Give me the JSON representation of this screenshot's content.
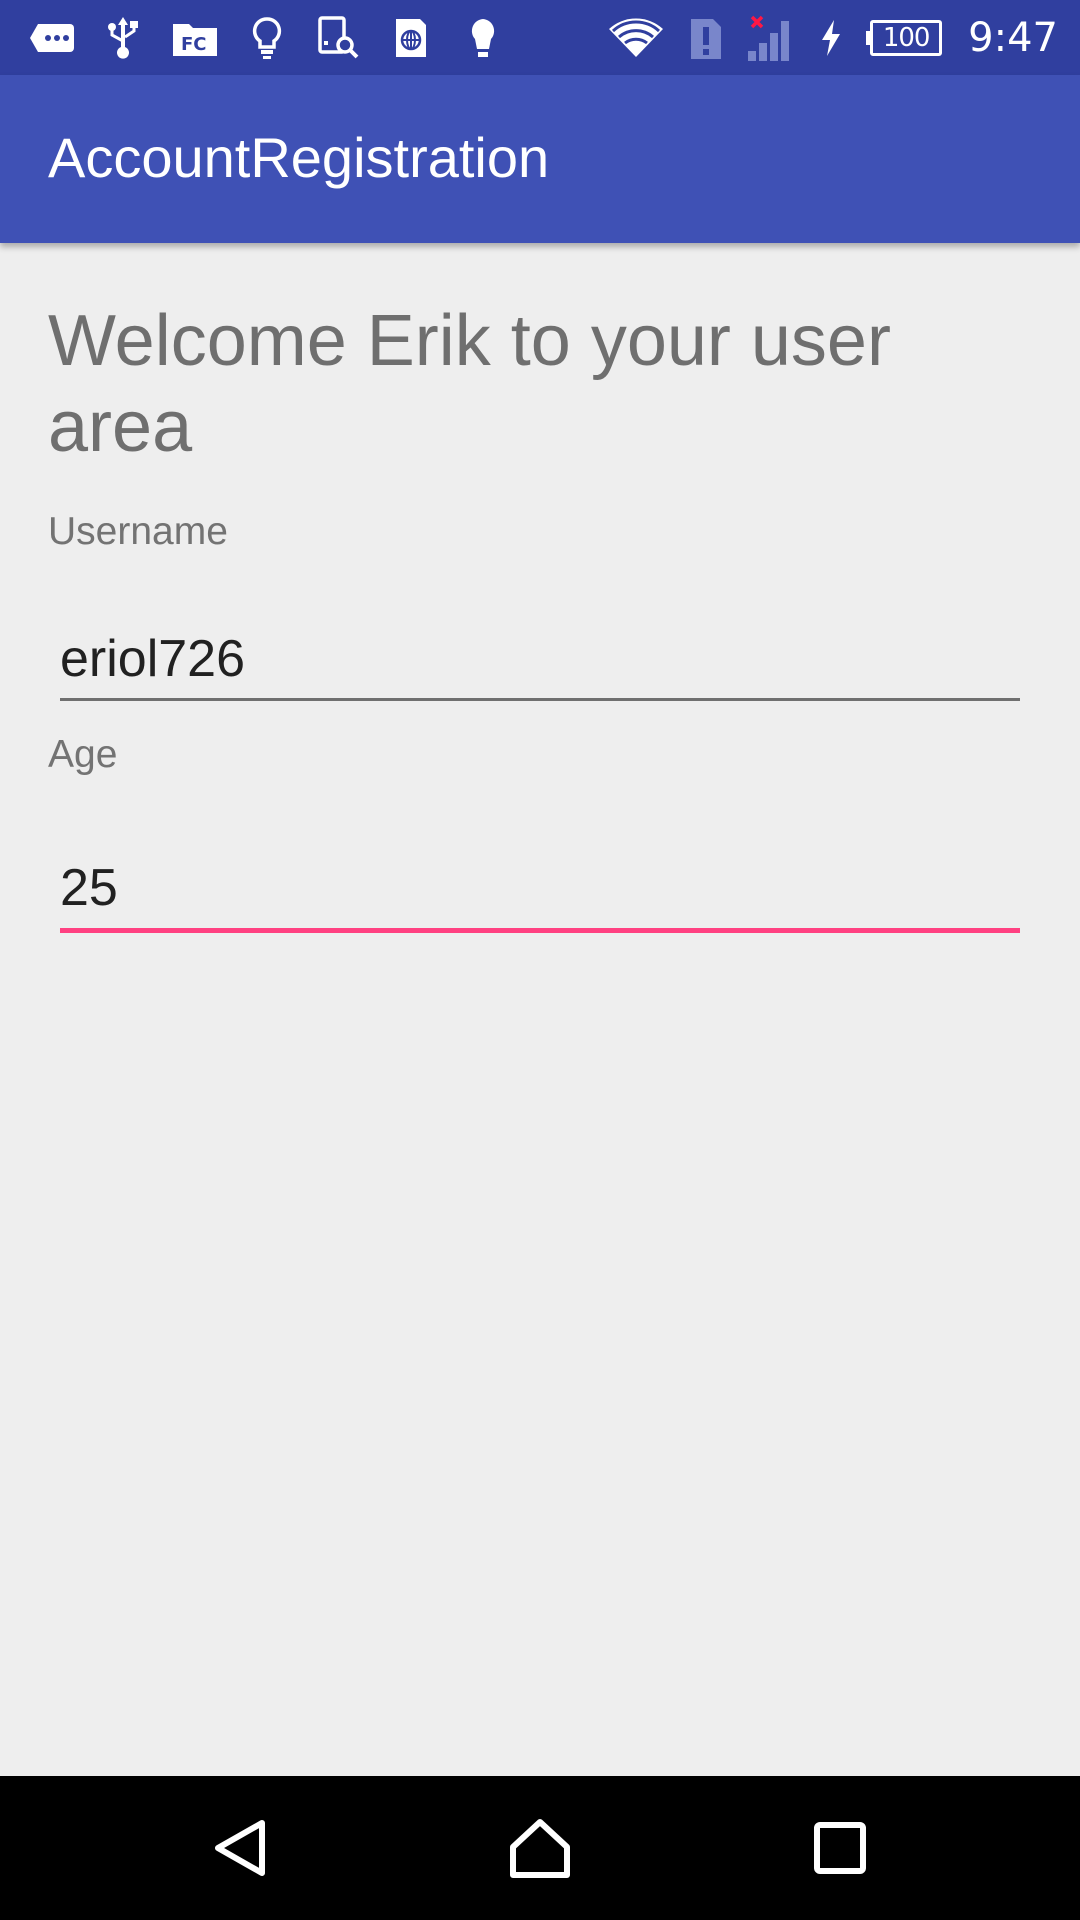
{
  "status_bar": {
    "icons": [
      "chat-bubble-icon",
      "usb-icon",
      "file-commander-icon",
      "lightbulb-icon",
      "tablet-search-icon",
      "sim-globe-icon",
      "bulb-icon",
      "wifi-icon",
      "sim-alert-icon",
      "signal-no-service-icon",
      "charging-bolt-icon"
    ],
    "battery_level": "100",
    "time": "9:47",
    "colors": {
      "background": "#303f9f",
      "icon": "#ffffff",
      "dim_icon": "#7986cb",
      "alert": "#ff1744"
    }
  },
  "app_bar": {
    "title": "AccountRegistration",
    "color": "#3f51b5"
  },
  "content": {
    "welcome_text": "Welcome Erik to your user area",
    "username": {
      "label": "Username",
      "value": "eriol726"
    },
    "age": {
      "label": "Age",
      "value": "25",
      "focused": true
    },
    "accent_color": "#ff4081"
  },
  "nav_bar": {
    "buttons": [
      "back-icon",
      "home-icon",
      "recents-icon"
    ]
  }
}
